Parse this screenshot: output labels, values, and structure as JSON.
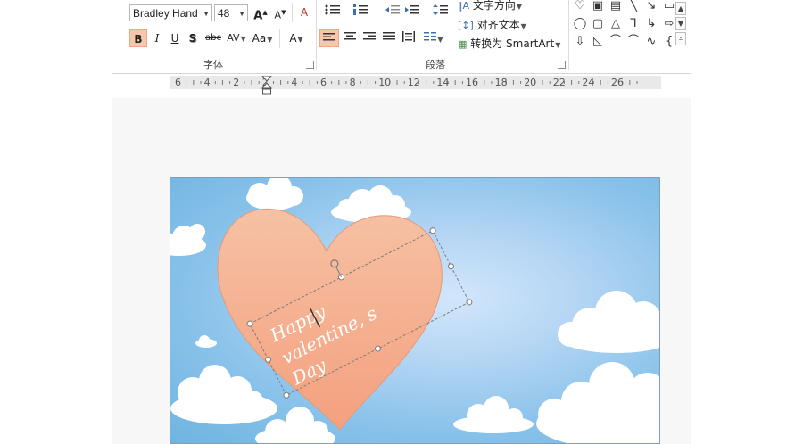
{
  "ribbon": {
    "font_group": {
      "label": "字体",
      "font_name": "Bradley Hand",
      "font_size": "48",
      "grow_font": "A",
      "shrink_font": "A",
      "clear_format": "A",
      "bold": "B",
      "italic": "I",
      "underline": "U",
      "shadow": "S",
      "strike": "abc",
      "spacing": "AV",
      "change_case": "Aa",
      "font_color": "A"
    },
    "paragraph_group": {
      "label": "段落",
      "text_direction": "文字方向",
      "align_text": "对齐文本",
      "convert_smartart": "转换为 SmartArt"
    }
  },
  "ruler": {
    "labels": [
      "6",
      "4",
      "2",
      "2",
      "4",
      "6",
      "8",
      "10",
      "12",
      "14",
      "16",
      "18",
      "20",
      "22",
      "24",
      "26"
    ]
  },
  "slide": {
    "text_lines": [
      "Happy",
      "valentine, s",
      "Day"
    ],
    "colors": {
      "heart_top": "#f6c1a4",
      "heart_bottom": "#f4a07e",
      "sky": "#89c2ea"
    }
  }
}
